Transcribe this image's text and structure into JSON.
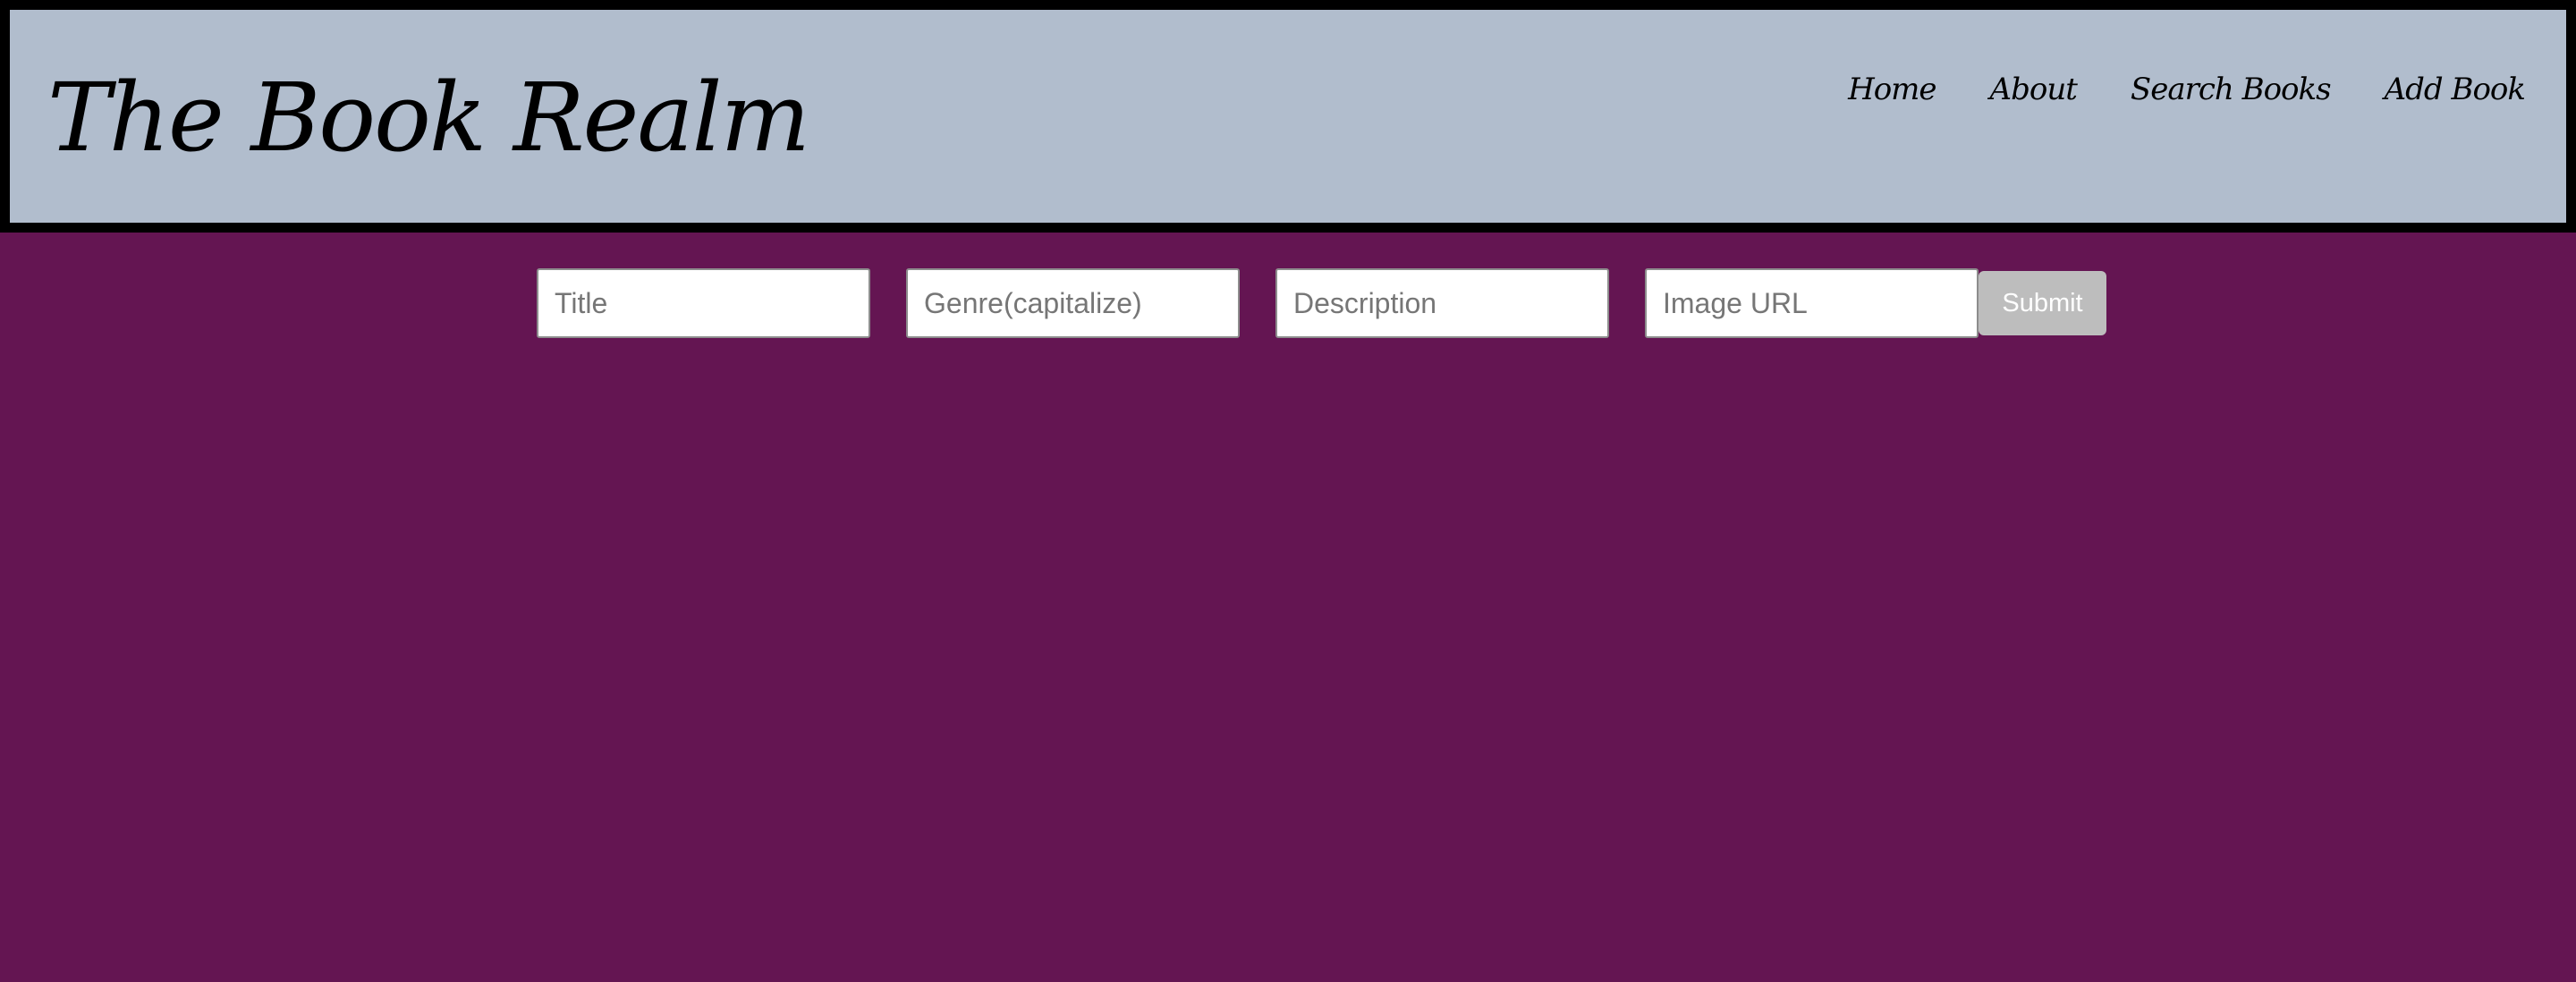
{
  "header": {
    "title": "The Book Realm",
    "nav": [
      {
        "label": "Home"
      },
      {
        "label": "About"
      },
      {
        "label": "Search Books"
      },
      {
        "label": "Add Book"
      }
    ]
  },
  "form": {
    "title_placeholder": "Title",
    "genre_placeholder": "Genre(capitalize)",
    "description_placeholder": "Description",
    "image_url_placeholder": "Image URL",
    "submit_label": "Submit"
  },
  "colors": {
    "header_bg": "#b1bdcd",
    "header_border": "#000000",
    "page_bg": "#641552",
    "submit_bg": "#bdbdbd"
  }
}
